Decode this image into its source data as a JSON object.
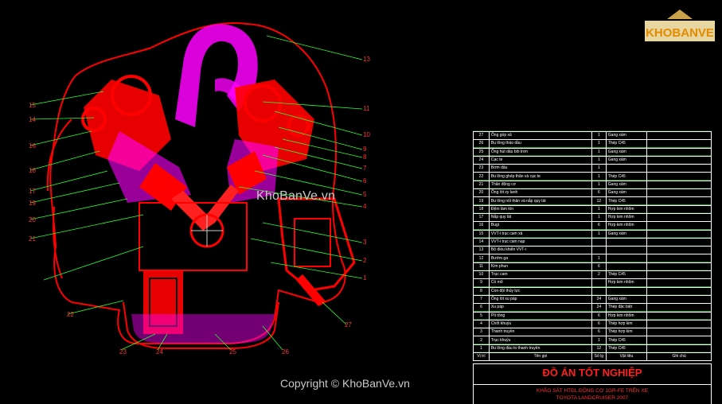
{
  "watermarks": {
    "center": "KhoBanVe.vn",
    "bottom": "Copyright © KhoBanVe.vn"
  },
  "logo": {
    "text": "KHOBANVE"
  },
  "callouts": {
    "top_right": [
      "13",
      "11",
      "10",
      "9",
      "8",
      "7",
      "6",
      "5",
      "4",
      "3",
      "2",
      "1"
    ],
    "left": [
      "15",
      "14",
      "16",
      "18",
      "17",
      "19",
      "20",
      "21"
    ],
    "bottom": [
      "22",
      "23",
      "24",
      "25",
      "26",
      "27"
    ]
  },
  "parts_table": {
    "headers": {
      "no": "Vị trí",
      "name": "Tên gọi",
      "qty": "Số lg",
      "material": "Vật liệu",
      "note": "Ghi chú"
    },
    "rows": [
      {
        "no": "27",
        "name": "Ống góp xả",
        "qty": "1",
        "material": "Gang xám"
      },
      {
        "no": "26",
        "name": "Bu lông tháo dầu",
        "qty": "1",
        "material": "Thép C45"
      },
      {
        "no": "25",
        "name": "Ống hút dầu bôi trơn",
        "qty": "1",
        "material": "Gang xám"
      },
      {
        "no": "24",
        "name": "Cạc te",
        "qty": "1",
        "material": "Gang xám"
      },
      {
        "no": "23",
        "name": "Bơm dầu",
        "qty": "1",
        "material": ""
      },
      {
        "no": "22",
        "name": "Bu lông ghép thân và cạc te",
        "qty": "1",
        "material": "Thép C45"
      },
      {
        "no": "21",
        "name": "Thân động cơ",
        "qty": "1",
        "material": "Gang xám"
      },
      {
        "no": "20",
        "name": "Ống lót xy lanh",
        "qty": "6",
        "material": "Gang xám"
      },
      {
        "no": "19",
        "name": "Bu lông nối thân và nắp quy lát",
        "qty": "12",
        "material": "Thép C45"
      },
      {
        "no": "18",
        "name": "Đệm làm kín",
        "qty": "1",
        "material": "Hợp kim nhôm"
      },
      {
        "no": "17",
        "name": "Nắp quy lát",
        "qty": "1",
        "material": "Hợp kim nhôm"
      },
      {
        "no": "16",
        "name": "Bugi",
        "qty": "6",
        "material": "Hợp kim nhôm"
      },
      {
        "no": "15",
        "name": "VVT-i trục cam xả",
        "qty": "1",
        "material": "Gang xám"
      },
      {
        "no": "14",
        "name": "VVT-i trục cam nạp",
        "qty": "",
        "material": ""
      },
      {
        "no": "13",
        "name": "Bộ điều khiển VVT-i",
        "qty": "",
        "material": ""
      },
      {
        "no": "12",
        "name": "Bướm ga",
        "qty": "1",
        "material": ""
      },
      {
        "no": "11",
        "name": "Kim phun",
        "qty": "6",
        "material": ""
      },
      {
        "no": "10",
        "name": "Trục cam",
        "qty": "2",
        "material": "Thép C45"
      },
      {
        "no": "9",
        "name": "Cò mổ",
        "qty": "",
        "material": "Hợp kim nhôm"
      },
      {
        "no": "8",
        "name": "Con đội thủy lực",
        "qty": "",
        "material": ""
      },
      {
        "no": "7",
        "name": "Ống lót xu páp",
        "qty": "24",
        "material": "Gang xám"
      },
      {
        "no": "6",
        "name": "Xu páp",
        "qty": "24",
        "material": "Thép đặc biệt"
      },
      {
        "no": "5",
        "name": "Pít tông",
        "qty": "6",
        "material": "Hợp kim nhôm"
      },
      {
        "no": "4",
        "name": "Chốt khuỷu",
        "qty": "6",
        "material": "Thép hợp kim"
      },
      {
        "no": "3",
        "name": "Thanh truyền",
        "qty": "6",
        "material": "Thép hợp kim"
      },
      {
        "no": "2",
        "name": "Trục khuỷu",
        "qty": "1",
        "material": "Thép C45"
      },
      {
        "no": "1",
        "name": "Bu lông đầu to thanh truyền",
        "qty": "12",
        "material": "Thép C45"
      }
    ]
  },
  "title_block": {
    "title": "ĐỒ ÁN TỐT NGHIỆP",
    "subtitle1": "KHẢO SÁT HTĐL ĐỘNG CƠ 1GR-FE TRÊN XE",
    "subtitle2": "TOYOTA LANDCRUISER 2007"
  },
  "colors": {
    "background": "#000000",
    "outline": "#ff0000",
    "accent": "#ff00ff",
    "leader": "#2aff2a",
    "grid": "#2aff2a"
  }
}
